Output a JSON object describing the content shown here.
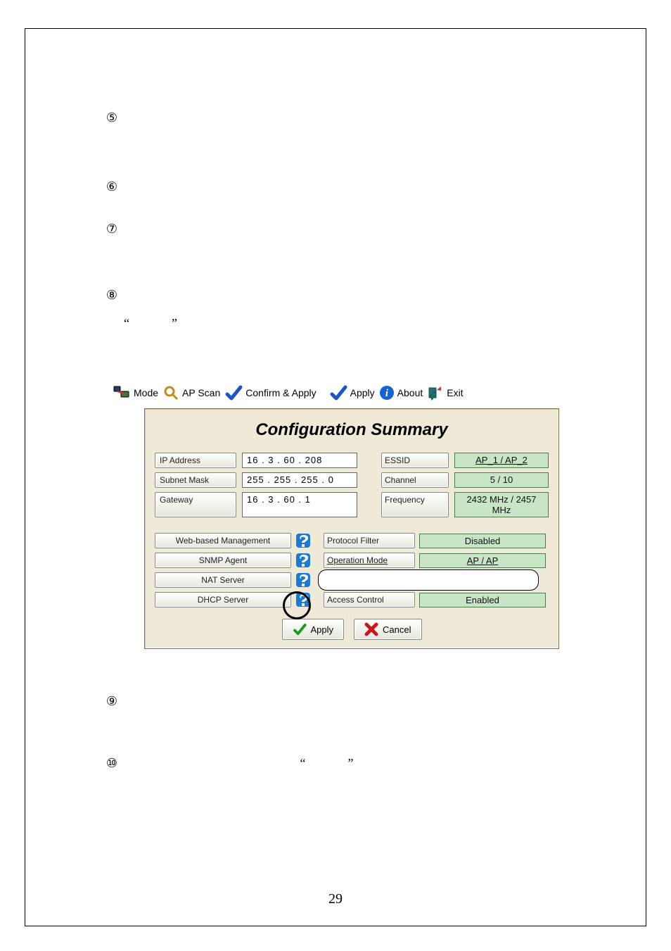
{
  "enum": {
    "n5": "⑤",
    "n6": "⑥",
    "n7": "⑦",
    "n8": "⑧",
    "n9": "⑨",
    "n10": "⑩",
    "lq": "“",
    "rq": "”"
  },
  "toolbar": {
    "mode": "Mode",
    "apscan": "AP Scan",
    "confirm": "Confirm & Apply",
    "apply": "Apply",
    "about": "About",
    "exit": "Exit"
  },
  "panel": {
    "title": "Configuration Summary",
    "labels": {
      "ip": "IP Address",
      "mask": "Subnet Mask",
      "gw": "Gateway",
      "essid": "ESSID",
      "channel": "Channel",
      "freq": "Frequency",
      "web": "Web-based Management",
      "snmp": "SNMP Agent",
      "nat": "NAT Server",
      "dhcp": "DHCP Server",
      "proto": "Protocol Filter",
      "opmode": "Operation Mode",
      "access": "Access Control"
    },
    "values": {
      "ip": "16  .  3  .  60  . 208",
      "mask": "255 . 255 . 255 .   0",
      "gw": "16  .  3  .  60  .   1",
      "essid": "AP_1 / AP_2",
      "channel": "5 / 10",
      "freq": "2432 MHz / 2457 MHz",
      "proto": "Disabled",
      "opmode": "AP / AP",
      "access": "Enabled"
    },
    "buttons": {
      "apply": "Apply",
      "cancel": "Cancel"
    }
  },
  "page_number": "29"
}
